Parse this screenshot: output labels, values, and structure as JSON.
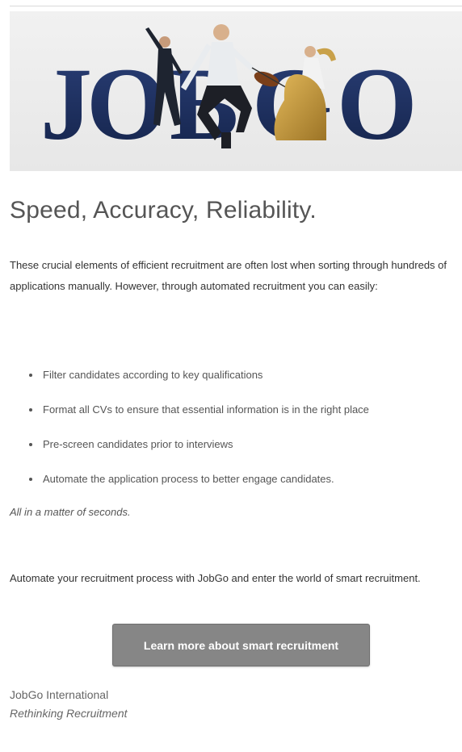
{
  "hero": {
    "logo_text": "JOBGO",
    "colors": {
      "navy": "#1b2d5c",
      "gold": "#c89a3a",
      "background": "#eeeeee"
    }
  },
  "headline": "Speed, Accuracy, Reliability.",
  "intro": "These crucial elements of efficient recruitment are often lost when sorting through hundreds of applications manually.  However, through automated recruitment you can easily:",
  "bullets": [
    "Filter candidates according to key qualifications",
    "Format all CVs to ensure that essential information is in the right place",
    "Pre-screen candidates prior to interviews",
    "Automate the application process to better engage candidates."
  ],
  "tagline": "All in a matter of seconds.",
  "cta": {
    "text": "Automate your recruitment process with JobGo and enter the world of smart recruitment.",
    "button_label": "Learn more about smart recruitment",
    "button_color": "#868686"
  },
  "signature": {
    "company": "JobGo International",
    "slogan": "Rethinking Recruitment"
  }
}
